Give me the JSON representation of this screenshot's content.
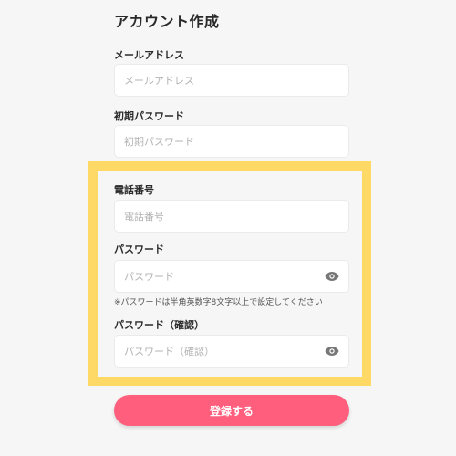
{
  "form": {
    "title": "アカウント作成",
    "email": {
      "label": "メールアドレス",
      "placeholder": "メールアドレス",
      "value": ""
    },
    "initial_password": {
      "label": "初期パスワード",
      "placeholder": "初期パスワード",
      "value": ""
    },
    "phone": {
      "label": "電話番号",
      "placeholder": "電話番号",
      "value": ""
    },
    "password": {
      "label": "パスワード",
      "placeholder": "パスワード",
      "value": "",
      "toggle_icon": "eye-icon"
    },
    "password_note": "※パスワードは半角英数字8文字以上で設定してください",
    "password_confirm": {
      "label": "パスワード（確認）",
      "placeholder": "パスワード（確認）",
      "value": "",
      "toggle_icon": "eye-icon"
    },
    "submit_label": "登録する"
  },
  "colors": {
    "background": "#f6f6f6",
    "highlight_border": "#ffd966",
    "submit_button": "#ff5e7d",
    "icon": "#777777"
  }
}
